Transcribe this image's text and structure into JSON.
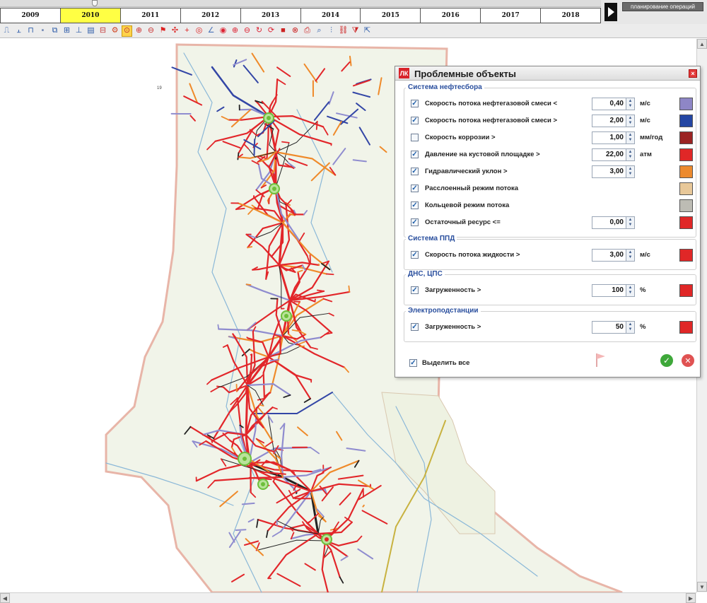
{
  "timeline": {
    "years": [
      "2009",
      "2010",
      "2011",
      "2012",
      "2013",
      "2014",
      "2015",
      "2016",
      "2017",
      "2018"
    ],
    "selected_year": "2010",
    "ops_button_label": "планирование операций"
  },
  "toolbar": {
    "icons": [
      "network-icon",
      "well-icon",
      "pipe-icon",
      "square-icon",
      "layers-icon",
      "tree-icon",
      "chart-icon",
      "doc-icon",
      "fields-icon",
      "tools-icon",
      "pin-select-icon",
      "pin-add-icon",
      "pin-remove-icon",
      "flag-icon",
      "node-icon",
      "plus-icon",
      "target-icon",
      "measure-icon",
      "zoom-icon",
      "zoom-in-icon",
      "zoom-out-icon",
      "rotate-icon",
      "refresh-icon",
      "red-square-icon",
      "alert-icon",
      "print-icon",
      "search-icon",
      "split-icon",
      "link-icon",
      "filter-icon",
      "export-icon"
    ],
    "selected_icon": "pin-select-icon"
  },
  "dialog": {
    "logo": "ЛК",
    "title": "Проблемные объекты",
    "close_symbol": "×",
    "groups": [
      {
        "title": "Система нефтесбора",
        "rows": [
          {
            "checked": true,
            "label": "Скорость потока нефтегазовой смеси <",
            "value": "0,40",
            "unit": "м/с",
            "color": "#8e86c6"
          },
          {
            "checked": true,
            "label": "Скорость потока нефтегазовой смеси >",
            "value": "2,00",
            "unit": "м/с",
            "color": "#2446a3"
          },
          {
            "checked": false,
            "label": "Скорость коррозии >",
            "value": "1,00",
            "unit": "мм/год",
            "color": "#9b2323"
          },
          {
            "checked": true,
            "label": "Давление на кустовой площадке >",
            "value": "22,00",
            "unit": "атм",
            "color": "#e02727"
          },
          {
            "checked": true,
            "label": "Гидравлический уклон >",
            "value": "3,00",
            "unit": "",
            "color": "#ec8a2e"
          },
          {
            "checked": true,
            "label": "Расслоенный режим потока",
            "value": null,
            "unit": "",
            "color": "#e8c899"
          },
          {
            "checked": true,
            "label": "Кольцевой режим потока",
            "value": null,
            "unit": "",
            "color": "#bdbcb4"
          },
          {
            "checked": true,
            "label": "Остаточный ресурс <=",
            "value": "0,00",
            "unit": "",
            "color": "#e02727"
          }
        ]
      },
      {
        "title": "Система ППД",
        "rows": [
          {
            "checked": true,
            "label": "Скорость потока жидкости >",
            "value": "3,00",
            "unit": "м/с",
            "color": "#e02727"
          }
        ]
      },
      {
        "title": "ДНС, ЦПС",
        "rows": [
          {
            "checked": true,
            "label": "Загруженность >",
            "value": "100",
            "unit": "%",
            "color": "#e02727"
          }
        ]
      },
      {
        "title": "Электроподстанции",
        "rows": [
          {
            "checked": true,
            "label": "Загруженность >",
            "value": "50",
            "unit": "%",
            "color": "#e02727"
          }
        ]
      }
    ],
    "select_all": {
      "checked": true,
      "label": "Выделить все"
    },
    "ok_symbol": "✓",
    "cancel_symbol": "✕"
  },
  "map": {
    "small_label": "19",
    "network_colors": {
      "red": "#e2262a",
      "orange": "#ef8a2a",
      "blue": "#3346a6",
      "lavender": "#8f8ccf",
      "black": "#222222",
      "river": "#8bb8d8",
      "boundary": "#e8b5a8",
      "fill": "#f1f4e9",
      "node": "#6dbf3a"
    }
  }
}
